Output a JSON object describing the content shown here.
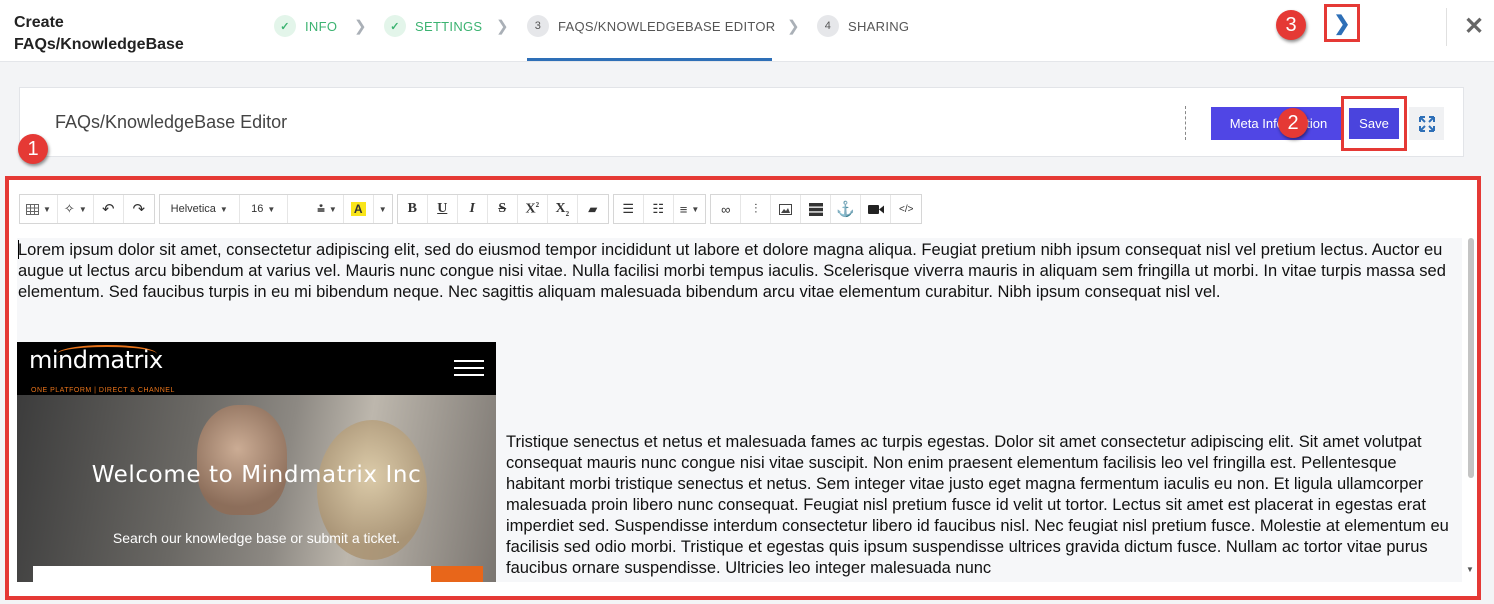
{
  "header": {
    "title": "Create FAQs/KnowledgeBase",
    "steps": [
      {
        "label": "INFO",
        "marker": "✓",
        "state": "done"
      },
      {
        "label": "SETTINGS",
        "marker": "✓",
        "state": "done"
      },
      {
        "label": "FAQS/KNOWLEDGEBASE EDITOR",
        "marker": "3",
        "state": "active"
      },
      {
        "label": "SHARING",
        "marker": "4",
        "state": "todo"
      }
    ],
    "next_icon": "chevron-right-icon",
    "close_label": "✕"
  },
  "editor_header": {
    "title": "FAQs/KnowledgeBase Editor",
    "meta_button": "Meta Information",
    "save_button": "Save",
    "expand_icon": "expand-icon"
  },
  "callouts": [
    "1",
    "2",
    "3"
  ],
  "toolbar": {
    "font_family": "Helvetica",
    "font_size": "16",
    "highlight_letter": "A"
  },
  "document": {
    "paragraph1": "Lorem ipsum dolor sit amet, consectetur adipiscing elit, sed do eiusmod tempor incididunt ut labore et dolore magna aliqua. Feugiat pretium nibh ipsum consequat nisl vel pretium lectus. Auctor eu augue ut lectus arcu bibendum at varius vel. Mauris nunc congue nisi vitae. Nulla facilisi morbi tempus iaculis. Scelerisque viverra mauris in aliquam sem fringilla ut morbi. In vitae turpis massa sed elementum. Sed faucibus turpis in eu mi bibendum neque. Nec sagittis aliquam malesuada bibendum arcu vitae elementum curabitur. Nibh ipsum consequat nisl vel.",
    "paragraph2": "Tristique senectus et netus et malesuada fames ac turpis egestas. Dolor sit amet consectetur adipiscing elit. Sit amet volutpat consequat mauris nunc congue nisi vitae suscipit. Non enim praesent elementum facilisis leo vel fringilla est. Pellentesque habitant morbi tristique senectus et netus. Sem integer vitae justo eget magna fermentum iaculis eu non. Et ligula ullamcorper malesuada proin libero nunc consequat. Feugiat nisl pretium fusce id velit ut tortor. Lectus sit amet est placerat in egestas erat imperdiet sed. Suspendisse interdum consectetur libero id faucibus nisl. Nec feugiat nisl pretium fusce. Molestie at elementum eu facilisis sed odio morbi. Tristique et egestas quis ipsum suspendisse ultrices gravida dictum fusce. Nullam ac tortor vitae purus faucibus ornare suspendisse. Ultricies leo integer malesuada nunc",
    "image": {
      "logo_text": "mindmatrix",
      "logo_tagline": "ONE PLATFORM | DIRECT & CHANNEL",
      "welcome": "Welcome to Mindmatrix Inc",
      "subtitle": "Search our knowledge base or submit a ticket."
    }
  },
  "colors": {
    "accent": "#2e6fb7",
    "done": "#3cb371",
    "meta_button": "#5046e5",
    "annotation_red": "#e53935",
    "brand_orange": "#e8661a"
  }
}
